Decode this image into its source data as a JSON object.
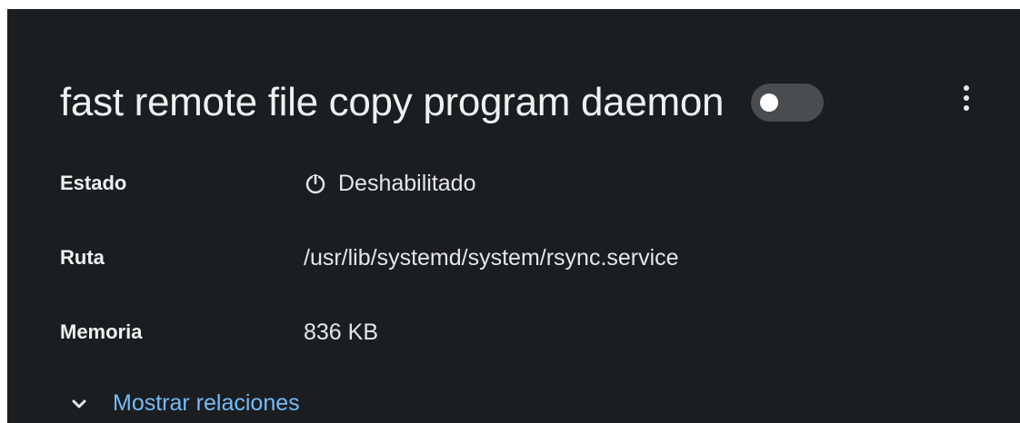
{
  "service": {
    "title": "fast remote file copy program daemon",
    "enabled": false
  },
  "toggle_icon": "toggle-switch-off",
  "menu_icon": "kebab-menu-icon",
  "details": {
    "estado": {
      "label": "Estado",
      "value": "Deshabilitado",
      "icon": "power-off-icon"
    },
    "ruta": {
      "label": "Ruta",
      "value": "/usr/lib/systemd/system/rsync.service"
    },
    "memoria": {
      "label": "Memoria",
      "value": "836 KB"
    }
  },
  "relations": {
    "label": "Mostrar relaciones",
    "icon": "chevron-down-icon"
  },
  "colors": {
    "background": "#1b1d21",
    "link": "#73bcf7",
    "toggle": "#4a4c50"
  }
}
